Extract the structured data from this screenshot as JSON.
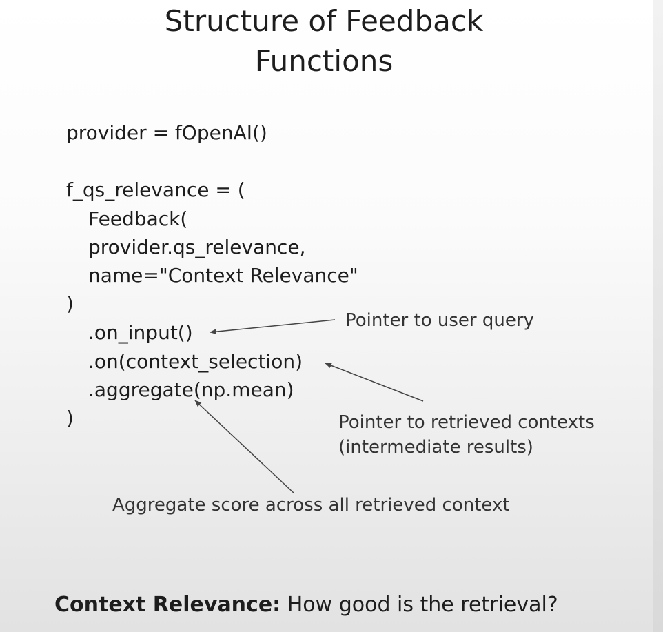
{
  "slide": {
    "title_line1": "Structure of Feedback",
    "title_line2": "Functions",
    "code": [
      "provider = fOpenAI()",
      "f_qs_relevance = (",
      "Feedback(",
      "provider.qs_relevance,",
      "name=\"Context Relevance\"",
      ")",
      ".on_input()",
      ".on(context_selection)",
      ".aggregate(np.mean)",
      ")"
    ],
    "annotations": {
      "user_query": "Pointer to user query",
      "retrieved_contexts_line1": "Pointer to retrieved contexts",
      "retrieved_contexts_line2": "(intermediate results)",
      "aggregate": "Aggregate score across all retrieved context"
    },
    "footer": {
      "bold": "Context Relevance:",
      "text": " How good is the retrieval?"
    },
    "colors": {
      "text": "#1d1d1d",
      "annotation": "#333333",
      "arrow": "#444444"
    }
  }
}
